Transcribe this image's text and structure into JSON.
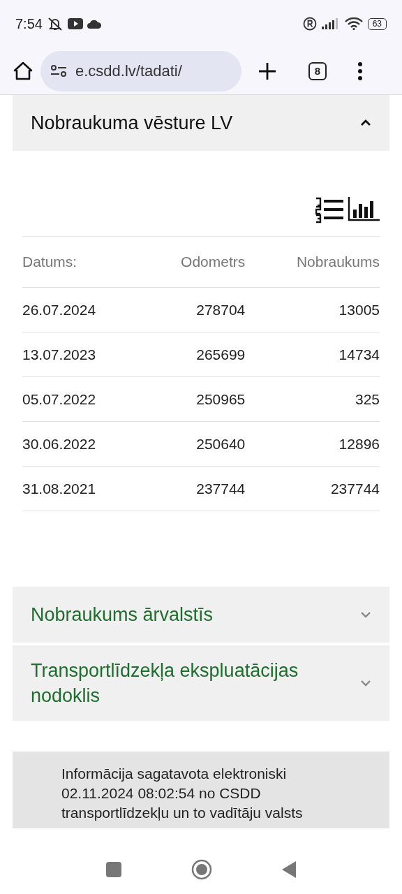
{
  "status_bar": {
    "time": "7:54",
    "battery": "63"
  },
  "browser": {
    "url": "e.csdd.lv/tadati/",
    "tab_count": "8"
  },
  "sections": [
    {
      "title": "Nobraukuma vēsture LV",
      "expanded": true,
      "table": {
        "columns": [
          "Datums:",
          "Odometrs",
          "Nobraukums"
        ],
        "rows": [
          [
            "26.07.2024",
            "278704",
            "13005"
          ],
          [
            "13.07.2023",
            "265699",
            "14734"
          ],
          [
            "05.07.2022",
            "250965",
            "325"
          ],
          [
            "30.06.2022",
            "250640",
            "12896"
          ],
          [
            "31.08.2021",
            "237744",
            "237744"
          ]
        ]
      }
    },
    {
      "title": "Nobraukums ārvalstīs",
      "expanded": false
    },
    {
      "title": "Transportlīdzekļa ekspluatācijas nodoklis",
      "expanded": false
    }
  ],
  "info": "Informācija sagatavota elektroniski 02.11.2024 08:02:54 no CSDD transportlīdzekļu un to vadītāju valsts"
}
